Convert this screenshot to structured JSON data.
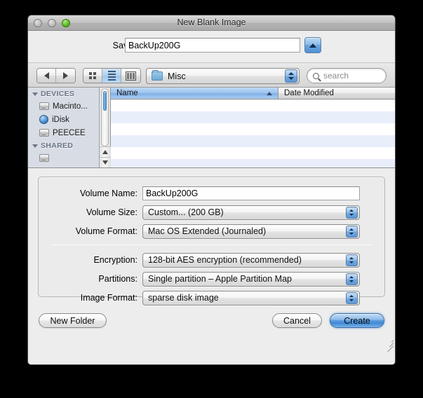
{
  "window": {
    "title": "New Blank Image",
    "traffic_lights": [
      {
        "name": "close",
        "enabled": false
      },
      {
        "name": "minimize",
        "enabled": false
      },
      {
        "name": "zoom",
        "enabled": true,
        "color": "#5dbd22"
      }
    ]
  },
  "save_as": {
    "label": "Save As:",
    "value": "BackUp200G",
    "disclosure_icon": "triangle-up-icon"
  },
  "toolbar": {
    "back_icon": "arrow-left-icon",
    "forward_icon": "arrow-right-icon",
    "view_modes": [
      {
        "name": "icon-view",
        "icon": "grid-icon",
        "selected": false
      },
      {
        "name": "list-view",
        "icon": "list-icon",
        "selected": true
      },
      {
        "name": "column-view",
        "icon": "columns-icon",
        "selected": false
      }
    ],
    "path_popup": {
      "icon": "folder-icon",
      "value": "Misc",
      "stepper_icon": "updown-arrows-icon"
    },
    "search": {
      "icon": "search-icon",
      "placeholder": "search",
      "value": ""
    }
  },
  "sidebar": {
    "sections": [
      {
        "title": "DEVICES",
        "expanded": true,
        "items": [
          {
            "label": "Macinto...",
            "icon": "hard-drive-icon"
          },
          {
            "label": "iDisk",
            "icon": "globe-icon"
          },
          {
            "label": "PEECEE",
            "icon": "hard-drive-icon"
          }
        ]
      },
      {
        "title": "SHARED",
        "expanded": true,
        "items": []
      }
    ]
  },
  "file_list": {
    "columns": [
      {
        "label": "Name",
        "sorted": true,
        "sort_direction": "ascending"
      },
      {
        "label": "Date Modified",
        "sorted": false
      }
    ],
    "rows": []
  },
  "form": {
    "fields": [
      {
        "label": "Volume Name:",
        "type": "text",
        "value": "BackUp200G"
      },
      {
        "label": "Volume Size:",
        "type": "popup",
        "value": "Custom... (200 GB)"
      },
      {
        "label": "Volume Format:",
        "type": "popup",
        "value": "Mac OS Extended (Journaled)"
      },
      {
        "label": "Encryption:",
        "type": "popup",
        "value": "128-bit AES encryption (recommended)"
      },
      {
        "label": "Partitions:",
        "type": "popup",
        "value": "Single partition – Apple Partition Map"
      },
      {
        "label": "Image Format:",
        "type": "popup",
        "value": "sparse disk image"
      }
    ]
  },
  "buttons": {
    "new_folder": "New Folder",
    "cancel": "Cancel",
    "create": "Create",
    "default_button_color": "#4f92d4"
  }
}
